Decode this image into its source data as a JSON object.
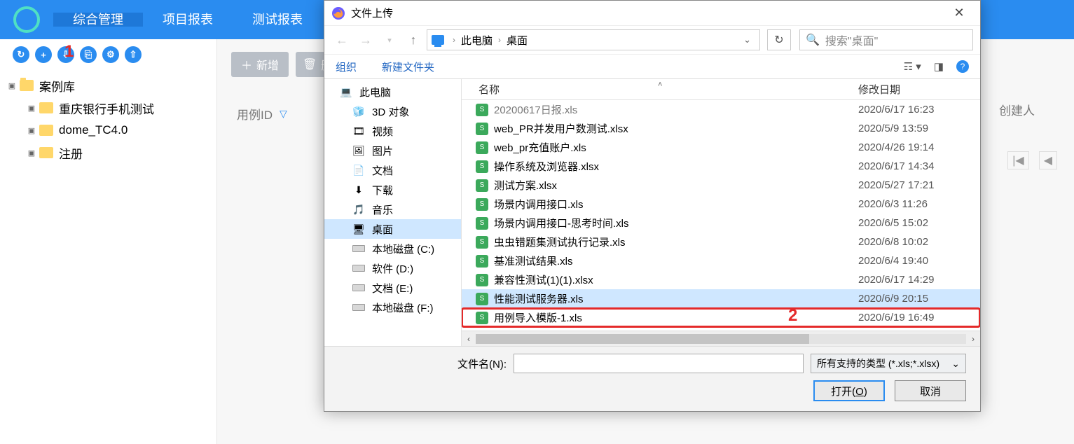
{
  "app": {
    "nav": {
      "items": [
        "综合管理",
        "项目报表",
        "测试报表"
      ],
      "active": 0
    },
    "toolbar_icons": [
      "↻",
      "+",
      "⇩",
      "⎘",
      "⚙",
      "⇧"
    ]
  },
  "sidebar": {
    "root": "案例库",
    "items": [
      {
        "label": "重庆银行手机测试"
      },
      {
        "label": "dome_TC4.0"
      },
      {
        "label": "注册"
      }
    ]
  },
  "main": {
    "btn_new": "新增",
    "btn_del": "删",
    "col_id": "用例ID",
    "creator": "创建人",
    "pager": {
      "first": "|◀",
      "prev": "◀"
    }
  },
  "annotations": {
    "one": "1",
    "two": "2"
  },
  "dialog": {
    "title": "文件上传",
    "breadcrumb": {
      "root": "此电脑",
      "current": "桌面"
    },
    "search_placeholder": "搜索\"桌面\"",
    "toolbar": {
      "organize": "组织",
      "new_folder": "新建文件夹"
    },
    "places": [
      {
        "label": "此电脑",
        "icon": "pc",
        "indent": false
      },
      {
        "label": "3D 对象",
        "icon": "cube",
        "indent": true
      },
      {
        "label": "视频",
        "icon": "video",
        "indent": true
      },
      {
        "label": "图片",
        "icon": "image",
        "indent": true
      },
      {
        "label": "文档",
        "icon": "doc",
        "indent": true
      },
      {
        "label": "下载",
        "icon": "download",
        "indent": true
      },
      {
        "label": "音乐",
        "icon": "music",
        "indent": true
      },
      {
        "label": "桌面",
        "icon": "desktop",
        "indent": true,
        "selected": true
      },
      {
        "label": "本地磁盘 (C:)",
        "icon": "drive",
        "indent": true
      },
      {
        "label": "软件 (D:)",
        "icon": "drive",
        "indent": true
      },
      {
        "label": "文档 (E:)",
        "icon": "drive",
        "indent": true
      },
      {
        "label": "本地磁盘 (F:)",
        "icon": "drive",
        "indent": true
      }
    ],
    "columns": {
      "name": "名称",
      "date": "修改日期"
    },
    "files": [
      {
        "name": "20200617日报.xls",
        "date": "2020/6/17 16:23",
        "partial": true
      },
      {
        "name": "web_PR并发用户数测试.xlsx",
        "date": "2020/5/9 13:59"
      },
      {
        "name": "web_pr充值账户.xls",
        "date": "2020/4/26 19:14"
      },
      {
        "name": "操作系统及浏览器.xlsx",
        "date": "2020/6/17 14:34"
      },
      {
        "name": "测试方案.xlsx",
        "date": "2020/5/27 17:21"
      },
      {
        "name": "场景内调用接口.xls",
        "date": "2020/6/3 11:26"
      },
      {
        "name": "场景内调用接口-思考时间.xls",
        "date": "2020/6/5 15:02"
      },
      {
        "name": "虫虫错题集测试执行记录.xls",
        "date": "2020/6/8 10:02"
      },
      {
        "name": "基准测试结果.xls",
        "date": "2020/6/4 19:40"
      },
      {
        "name": "兼容性测试(1)(1).xlsx",
        "date": "2020/6/17 14:29"
      },
      {
        "name": "性能测试服务器.xls",
        "date": "2020/6/9 20:15",
        "selected": true
      },
      {
        "name": "用例导入模版-1.xls",
        "date": "2020/6/19 16:49",
        "highlight": true
      }
    ],
    "filename_label": "文件名(N):",
    "filetype": "所有支持的类型 (*.xls;*.xlsx)",
    "btn_open": "打开(O)",
    "btn_cancel": "取消"
  }
}
